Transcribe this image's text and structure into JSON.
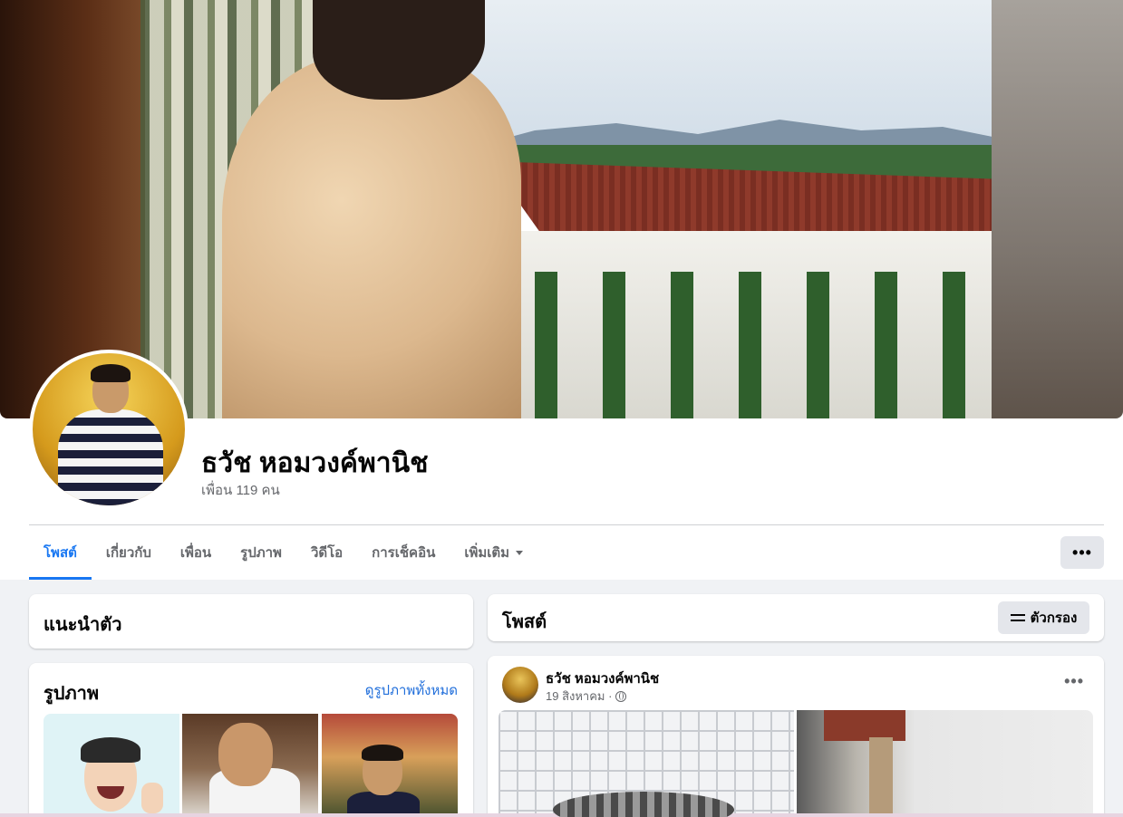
{
  "profile": {
    "name": "ธวัช หอมวงค์พานิช",
    "friends": "เพื่อน 119 คน"
  },
  "tabs": [
    {
      "label": "โพสต์",
      "active": true
    },
    {
      "label": "เกี่ยวกับ",
      "active": false
    },
    {
      "label": "เพื่อน",
      "active": false
    },
    {
      "label": "รูปภาพ",
      "active": false
    },
    {
      "label": "วิดีโอ",
      "active": false
    },
    {
      "label": "การเช็คอิน",
      "active": false
    },
    {
      "label": "เพิ่มเติม",
      "active": false
    }
  ],
  "more_button": "•••",
  "intro": {
    "title": "แนะนำตัว"
  },
  "photos": {
    "title": "รูปภาพ",
    "see_all": "ดูรูปภาพทั้งหมด"
  },
  "posts": {
    "title": "โพสต์",
    "filter_label": "ตัวกรอง"
  },
  "post": {
    "author": "ธวัช หอมวงค์พานิช",
    "date": "19 สิงหาคม ·",
    "more": "•••"
  },
  "colors": {
    "accent": "#1877f2",
    "link": "#216fdb",
    "background": "#f0f2f5",
    "secondary_text": "#65676b"
  }
}
